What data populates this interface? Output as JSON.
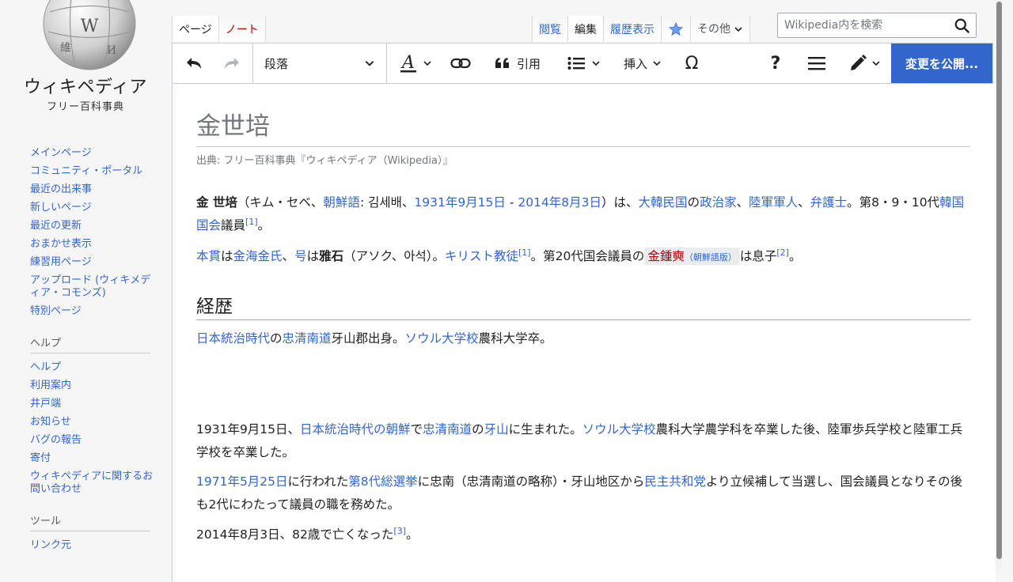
{
  "logo": {
    "wordmark": "ウィキペディア",
    "tagline": "フリー百科事典"
  },
  "sidebar": {
    "nav": [
      "メインページ",
      "コミュニティ・ポータル",
      "最近の出来事",
      "新しいページ",
      "最近の更新",
      "おまかせ表示",
      "練習用ページ",
      "アップロード (ウィキメディア・コモンズ)",
      "特別ページ"
    ],
    "help_heading": "ヘルプ",
    "help": [
      "ヘルプ",
      "利用案内",
      "井戸端",
      "お知らせ",
      "バグの報告",
      "寄付",
      "ウィキペディアに関するお問い合わせ"
    ],
    "tools_heading": "ツール",
    "tools": [
      "リンク元"
    ]
  },
  "tabs": {
    "page": "ページ",
    "talk": "ノート",
    "read": "閲覧",
    "edit": "編集",
    "history": "履歴表示",
    "more": "その他"
  },
  "search": {
    "placeholder": "Wikipedia内を検索"
  },
  "toolbar": {
    "paragraph": "段落",
    "cite": "引用",
    "insert": "挿入",
    "publish": "変更を公開..."
  },
  "article": {
    "title": "金世培",
    "site_sub": "出典: フリー百科事典『ウィキペディア（Wikipedia）』",
    "p1": {
      "name": "金 世培",
      "t1": "（キム・セベ、",
      "link_korean": "朝鮮語",
      "t2": ": 김세배、",
      "link_birth": "1931年9月15日",
      "t3": " - ",
      "link_death": "2014年8月3日",
      "t4": "）は、",
      "link_rok": "大韓民国",
      "t5": "の",
      "link_politician": "政治家",
      "t6": "、",
      "link_soldier": "陸軍軍人",
      "t7": "、",
      "link_lawyer": "弁護士",
      "t8": "。第8・9・10代",
      "link_assembly": "韓国国会",
      "t9": "議員",
      "ref1": "[1]",
      "t10": "。"
    },
    "p2": {
      "link_origin": "本貫",
      "t1": "は",
      "link_clan": "金海金氏",
      "t2": "、",
      "link_ho": "号",
      "t3": "は",
      "ho": "雅石",
      "t4": "（アソク、아석）。",
      "link_christian": "キリスト教徒",
      "ref1": "[1]",
      "t5": "。第20代国会議員の",
      "son_name": "金鍾奭",
      "son_lang": "（朝鮮語版）",
      "t6": "は息子",
      "ref2": "[2]",
      "t7": "。"
    },
    "section_title": "経歴",
    "p3": {
      "link_era": "日本統治時代",
      "t1": "の",
      "link_province": "忠清南道",
      "t2": "牙山郡出身。",
      "link_univ": "ソウル大学校",
      "t3": "農科大学卒。"
    },
    "p4": {
      "t1": "1931年9月15日、",
      "link_korea": "日本統治時代の朝鮮",
      "t2": "で",
      "link_province": "忠清南道",
      "t3": "の",
      "link_asan": "牙山",
      "t4": "に生まれた。",
      "link_univ": "ソウル大学校",
      "t5": "農科大学農学科を卒業した後、陸軍歩兵学校と陸軍工兵学校を卒業した。"
    },
    "p5": {
      "link_date": "1971年5月25日",
      "t1": "に行われた",
      "link_election": "第8代総選挙",
      "t2": "に忠南（忠清南道の略称）・牙山地区から",
      "link_party": "民主共和党",
      "t3": "より立候補して当選し、国会議員となりその後も2代にわたって議員の職を務めた。"
    },
    "p6": {
      "t1": "2014年8月3日、82歳で亡くなった",
      "ref3": "[3]",
      "t2": "。"
    }
  }
}
